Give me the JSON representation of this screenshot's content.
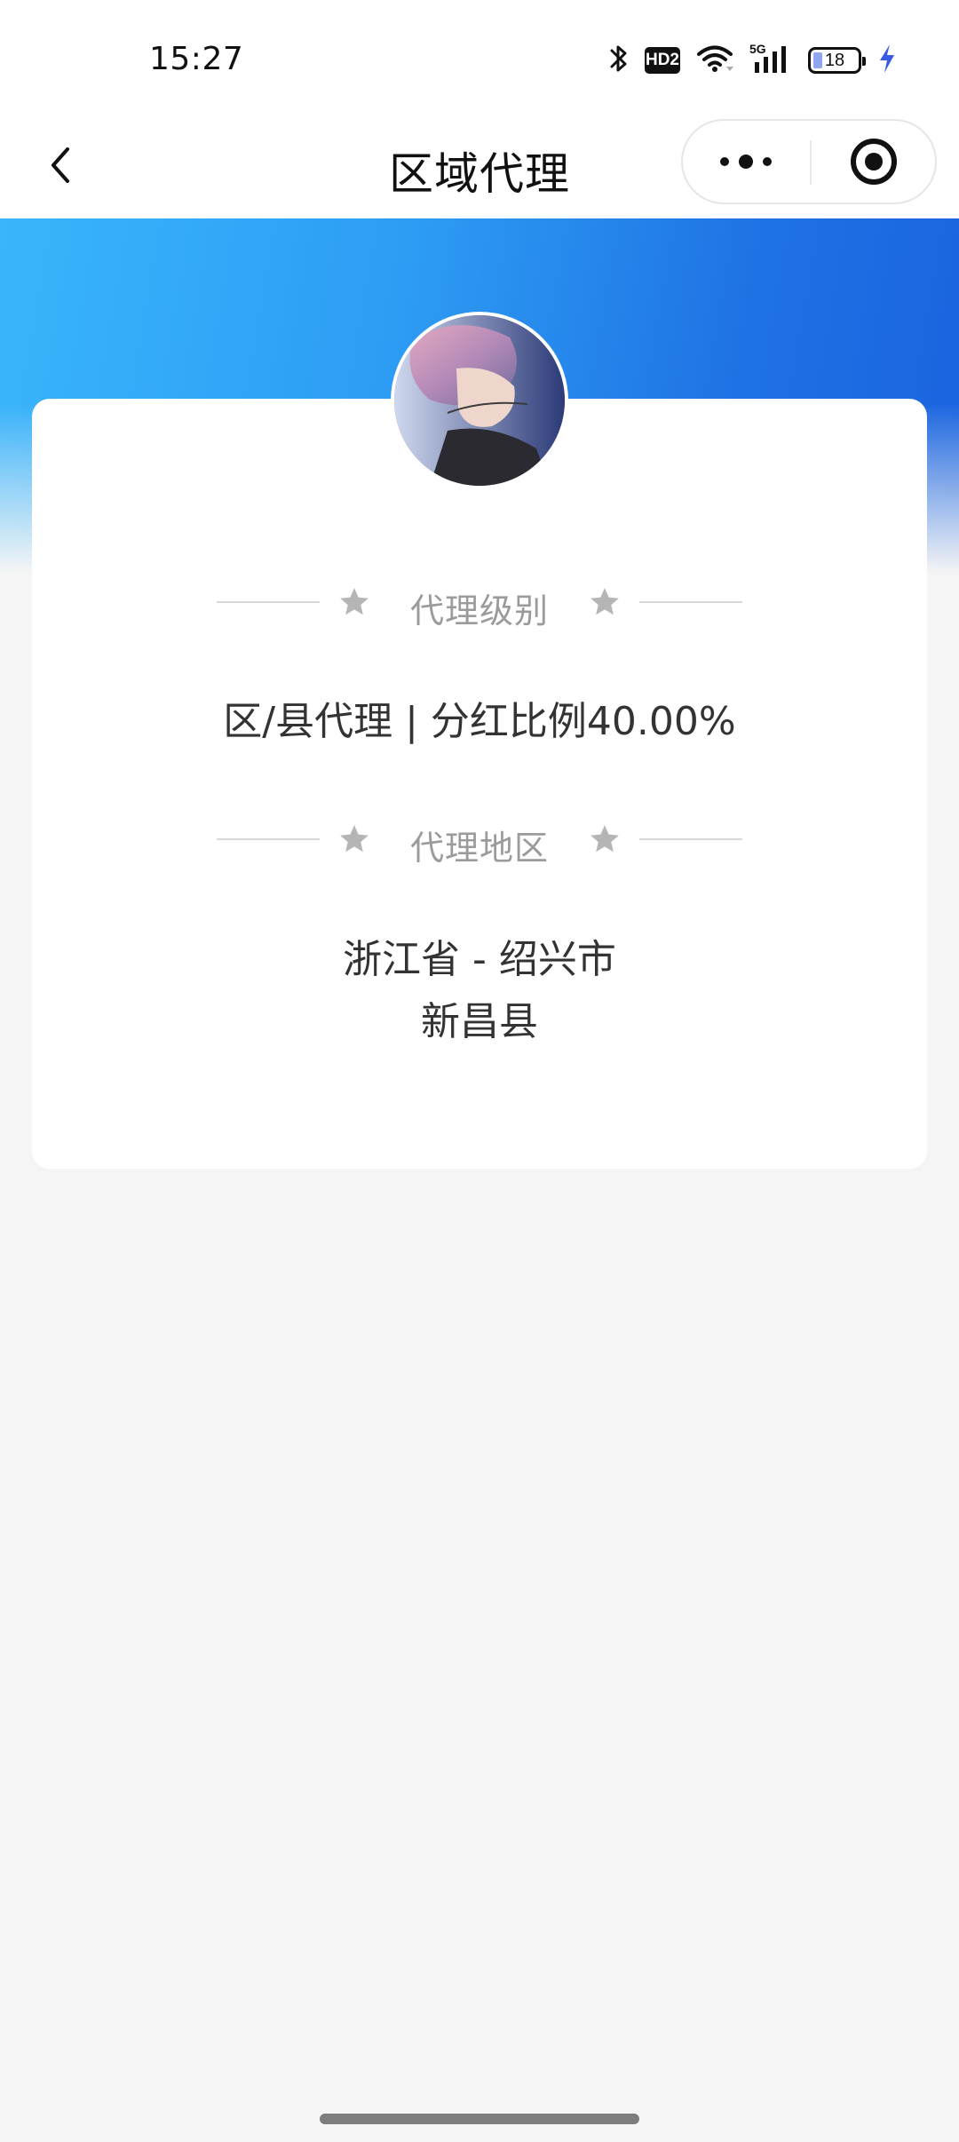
{
  "status_bar": {
    "time": "15:27",
    "hd_label": "HD2",
    "network_label": "5G",
    "battery_level": "18",
    "icons": [
      "bluetooth-icon",
      "hd-voice-icon",
      "wifi-icon",
      "cellular-5g-icon",
      "battery-icon",
      "charging-icon"
    ]
  },
  "nav": {
    "title": "区域代理",
    "back_icon": "chevron-left-icon",
    "more_icon": "more-dots-icon",
    "close_icon": "target-close-icon"
  },
  "colors": {
    "gradient_start": "#39b5fb",
    "gradient_end": "#1a63df",
    "page_background": "#f5f5f5",
    "card_background": "#ffffff",
    "label_gray": "#9b9b9b",
    "text_dark": "#333333"
  },
  "card": {
    "avatar": "user-avatar",
    "level_section_label": "代理级别",
    "level_value": "区/县代理 | 分红比例40.00%",
    "region_section_label": "代理地区",
    "region_line1": "浙江省 - 绍兴市",
    "region_line2": "新昌县",
    "star_icon": "star-icon"
  }
}
